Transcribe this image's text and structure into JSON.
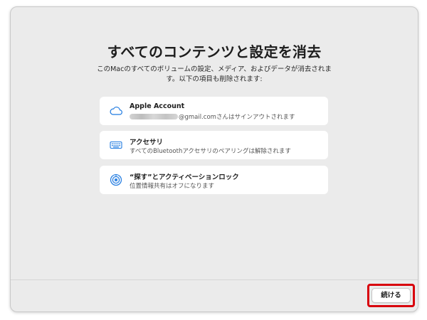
{
  "dialog": {
    "title": "すべてのコンテンツと設定を消去",
    "description": "このMacのすべてのボリュームの設定、メディア、およびデータが消去されます。以下の項目も削除されます:"
  },
  "items": [
    {
      "icon": "cloud-icon",
      "title": "Apple Account",
      "subtitle_suffix": "@gmail.comさんはサインアウトされます"
    },
    {
      "icon": "keyboard-icon",
      "title": "アクセサリ",
      "subtitle": "すべてのBluetoothアクセサリのペアリングは解除されます"
    },
    {
      "icon": "find-my-icon",
      "title": "“探す”とアクティベーションロック",
      "subtitle": "位置情報共有はオフになります"
    }
  ],
  "footer": {
    "continue_label": "続ける"
  },
  "colors": {
    "window_bg": "#ebebeb",
    "card_bg": "#ffffff",
    "icon_blue": "#1f7ae0",
    "highlight_red": "#d8000c"
  }
}
